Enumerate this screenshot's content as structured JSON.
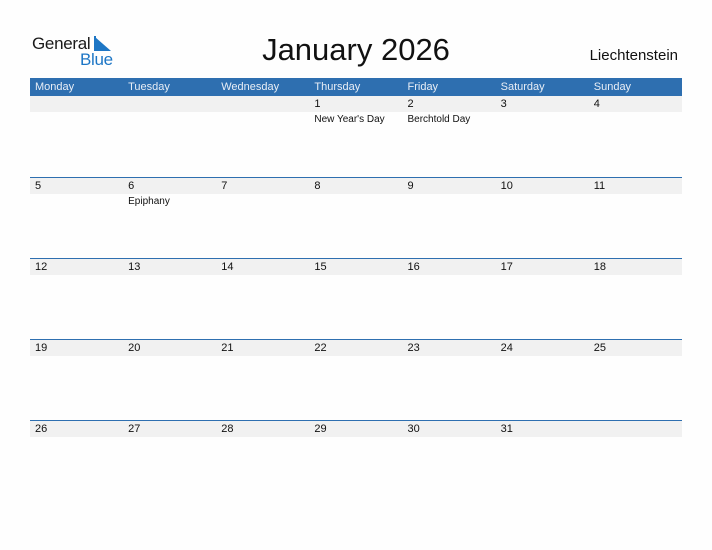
{
  "logo": {
    "word1": "General",
    "word2": "Blue"
  },
  "title": "January 2026",
  "country": "Liechtenstein",
  "colors": {
    "header_bg": "#2e6fb0",
    "brand_blue": "#1d76c5",
    "date_strip": "#f1f1f1"
  },
  "weekdays": [
    "Monday",
    "Tuesday",
    "Wednesday",
    "Thursday",
    "Friday",
    "Saturday",
    "Sunday"
  ],
  "weeks": [
    [
      {
        "day": "",
        "holiday": ""
      },
      {
        "day": "",
        "holiday": ""
      },
      {
        "day": "",
        "holiday": ""
      },
      {
        "day": "1",
        "holiday": "New Year's Day"
      },
      {
        "day": "2",
        "holiday": "Berchtold Day"
      },
      {
        "day": "3",
        "holiday": ""
      },
      {
        "day": "4",
        "holiday": ""
      }
    ],
    [
      {
        "day": "5",
        "holiday": ""
      },
      {
        "day": "6",
        "holiday": "Epiphany"
      },
      {
        "day": "7",
        "holiday": ""
      },
      {
        "day": "8",
        "holiday": ""
      },
      {
        "day": "9",
        "holiday": ""
      },
      {
        "day": "10",
        "holiday": ""
      },
      {
        "day": "11",
        "holiday": ""
      }
    ],
    [
      {
        "day": "12",
        "holiday": ""
      },
      {
        "day": "13",
        "holiday": ""
      },
      {
        "day": "14",
        "holiday": ""
      },
      {
        "day": "15",
        "holiday": ""
      },
      {
        "day": "16",
        "holiday": ""
      },
      {
        "day": "17",
        "holiday": ""
      },
      {
        "day": "18",
        "holiday": ""
      }
    ],
    [
      {
        "day": "19",
        "holiday": ""
      },
      {
        "day": "20",
        "holiday": ""
      },
      {
        "day": "21",
        "holiday": ""
      },
      {
        "day": "22",
        "holiday": ""
      },
      {
        "day": "23",
        "holiday": ""
      },
      {
        "day": "24",
        "holiday": ""
      },
      {
        "day": "25",
        "holiday": ""
      }
    ],
    [
      {
        "day": "26",
        "holiday": ""
      },
      {
        "day": "27",
        "holiday": ""
      },
      {
        "day": "28",
        "holiday": ""
      },
      {
        "day": "29",
        "holiday": ""
      },
      {
        "day": "30",
        "holiday": ""
      },
      {
        "day": "31",
        "holiday": ""
      },
      {
        "day": "",
        "holiday": ""
      }
    ]
  ]
}
